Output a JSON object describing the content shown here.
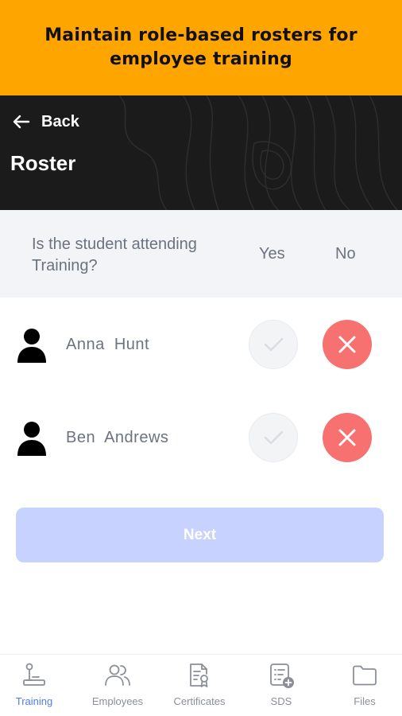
{
  "banner": {
    "text": "Maintain role-based rosters for employee training"
  },
  "header": {
    "back_label": "Back",
    "title": "Roster"
  },
  "attendance": {
    "question": "Is the student attending Training?",
    "yes_label": "Yes",
    "no_label": "No"
  },
  "students": [
    {
      "name": "Anna  Hunt",
      "attending": "no"
    },
    {
      "name": "Ben  Andrews",
      "attending": "no"
    }
  ],
  "next_button": {
    "label": "Next",
    "enabled": false
  },
  "bottom_nav": {
    "items": [
      {
        "label": "Training",
        "icon": "training-icon",
        "active": true
      },
      {
        "label": "Employees",
        "icon": "employees-icon",
        "active": false
      },
      {
        "label": "Certificates",
        "icon": "certificate-icon",
        "active": false
      },
      {
        "label": "SDS",
        "icon": "sds-icon",
        "active": false
      },
      {
        "label": "Files",
        "icon": "folder-icon",
        "active": false
      }
    ]
  },
  "colors": {
    "banner": "#ffa500",
    "header": "#1b1b1b",
    "no_active": "#f87171",
    "next_disabled": "#c7d2fe",
    "nav_active": "#4f7cf0"
  }
}
